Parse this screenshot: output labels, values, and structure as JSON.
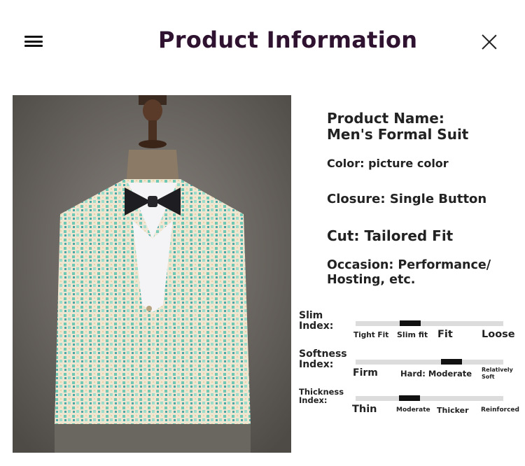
{
  "header": {
    "title": "Product Information"
  },
  "product": {
    "name": "Product Name: Men's Formal Suit",
    "color": "Color: picture color",
    "closure": "Closure: Single Button",
    "cut": "Cut: Tailored Fit",
    "occasion": "Occasion: Performance/ Hosting, etc."
  },
  "indices": {
    "slim": {
      "label": "Slim Index:",
      "ticks": [
        "Tight Fit",
        "Slim fit",
        "Fit",
        "Loose"
      ],
      "selected": "Slim fit"
    },
    "softness": {
      "label": "Softness Index:",
      "ticks": [
        "Firm",
        "Hard: Moderate",
        "Relatively Soft"
      ],
      "selected": "Hard: Moderate"
    },
    "thickness": {
      "label": "Thickness Index:",
      "ticks": [
        "Thin",
        "Moderate",
        "Thicker",
        "Reinforced"
      ],
      "selected": "Moderate"
    }
  },
  "colors": {
    "title": "#2e1230",
    "bar": "#dcdcdc",
    "marker": "#111111"
  }
}
